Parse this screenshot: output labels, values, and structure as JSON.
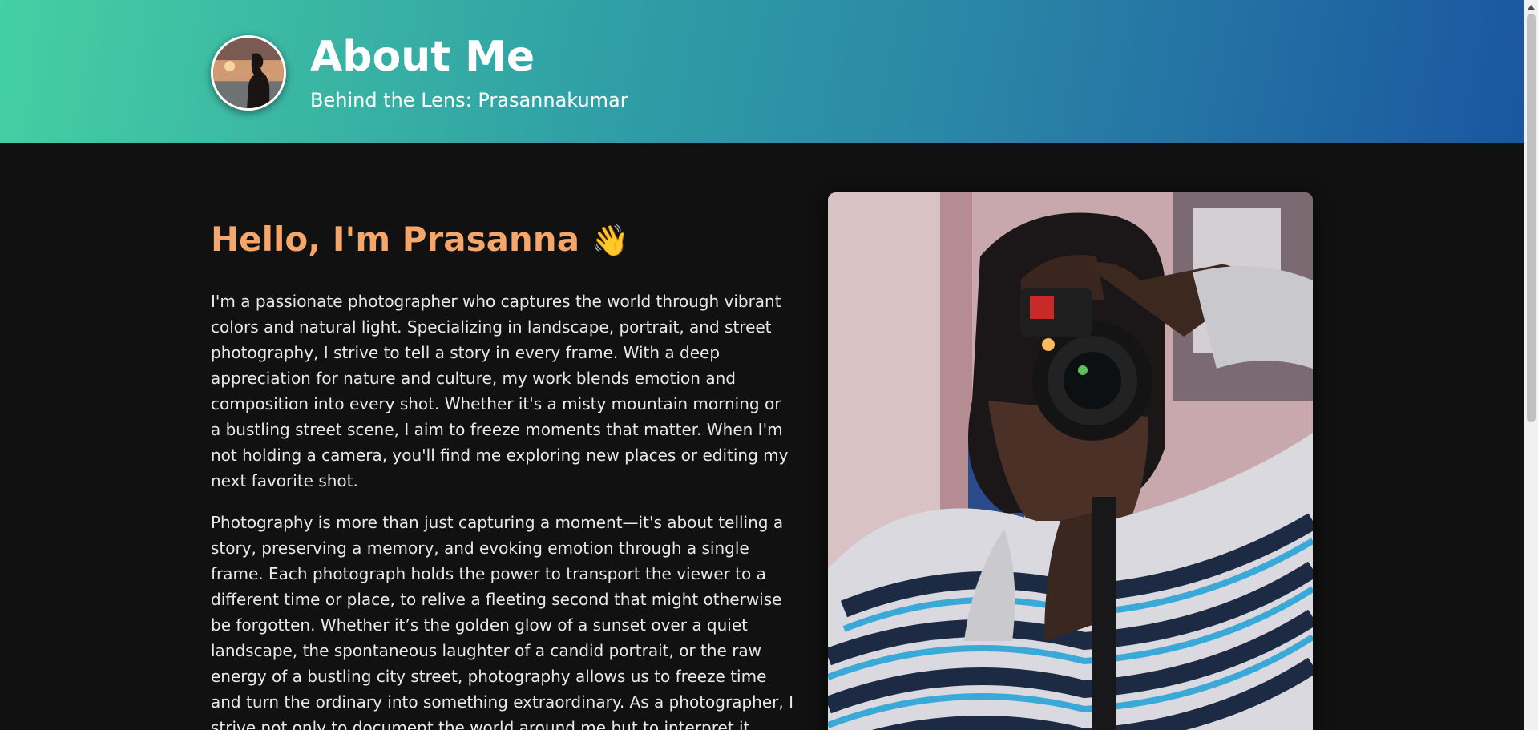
{
  "header": {
    "title": "About Me",
    "subtitle": "Behind the Lens: Prasannakumar",
    "avatar_icon": "profile-avatar"
  },
  "main": {
    "greeting": "Hello, I'm Prasanna",
    "greeting_emoji": "👋",
    "paragraphs": [
      "I'm a passionate photographer who captures the world through vibrant colors and natural light. Specializing in landscape, portrait, and street photography, I strive to tell a story in every frame. With a deep appreciation for nature and culture, my work blends emotion and composition into every shot. Whether it's a misty mountain morning or a bustling street scene, I aim to freeze moments that matter. When I'm not holding a camera, you'll find me exploring new places or editing my next favorite shot.",
      "Photography is more than just capturing a moment—it's about telling a story, preserving a memory, and evoking emotion through a single frame. Each photograph holds the power to transport the viewer to a different time or place, to relive a fleeting second that might otherwise be forgotten. Whether it’s the golden glow of a sunset over a quiet landscape, the spontaneous laughter of a candid portrait, or the raw energy of a bustling city street, photography allows us to freeze time and turn the ordinary into something extraordinary. As a photographer, I strive not only to document the world around me but to interpret it"
    ]
  },
  "colors": {
    "header_gradient_start": "#45cfa3",
    "header_gradient_end": "#1a56a0",
    "background": "#111111",
    "greeting": "#f5a66a",
    "text": "#e9e9e9"
  }
}
